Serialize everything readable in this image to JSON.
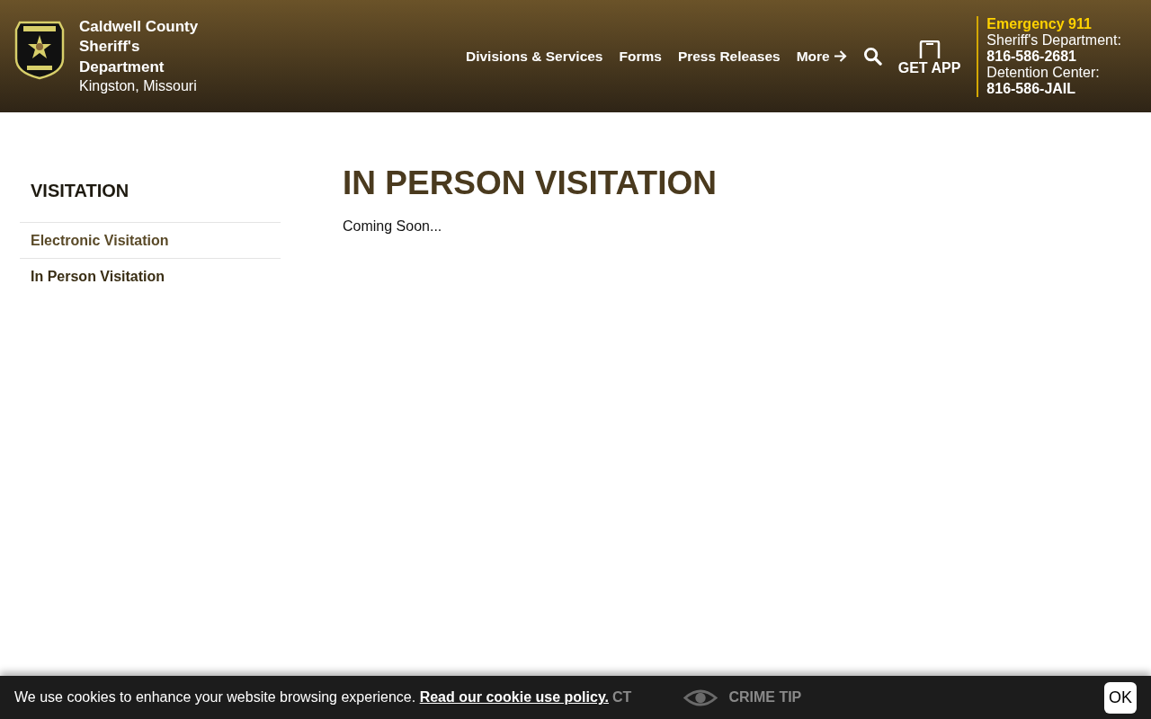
{
  "header": {
    "title": "Caldwell County Sheriff's Department",
    "location": "Kingston, Missouri",
    "nav": [
      {
        "label": "Divisions & Services",
        "kind": "link"
      },
      {
        "label": "Forms",
        "kind": "link"
      },
      {
        "label": "Press Releases",
        "kind": "link"
      },
      {
        "label": "More",
        "kind": "more"
      }
    ],
    "app_button": "GET APP",
    "contacts": {
      "emergency": "Emergency 911",
      "lines": [
        {
          "label": "Sheriff's Department:",
          "number": "816-586-2681"
        },
        {
          "label": "Detention Center:",
          "number": "816-586-JAIL"
        }
      ]
    }
  },
  "sidebar": {
    "heading": "VISITATION",
    "items": [
      {
        "label": "Electronic Visitation",
        "selected": false
      },
      {
        "label": "In Person Visitation",
        "selected": true
      }
    ]
  },
  "content": {
    "title": "IN PERSON VISITATION",
    "body": "Coming Soon..."
  },
  "cookie_bar": {
    "text": "We use cookies to enhance your website browsing experience.",
    "link": "Read our cookie use policy.",
    "button": "OK"
  },
  "bottom_bar": {
    "items": [
      {
        "label": "CT",
        "kind": "chat"
      },
      {
        "label": "CRIME TIP",
        "kind": "eye"
      }
    ]
  }
}
